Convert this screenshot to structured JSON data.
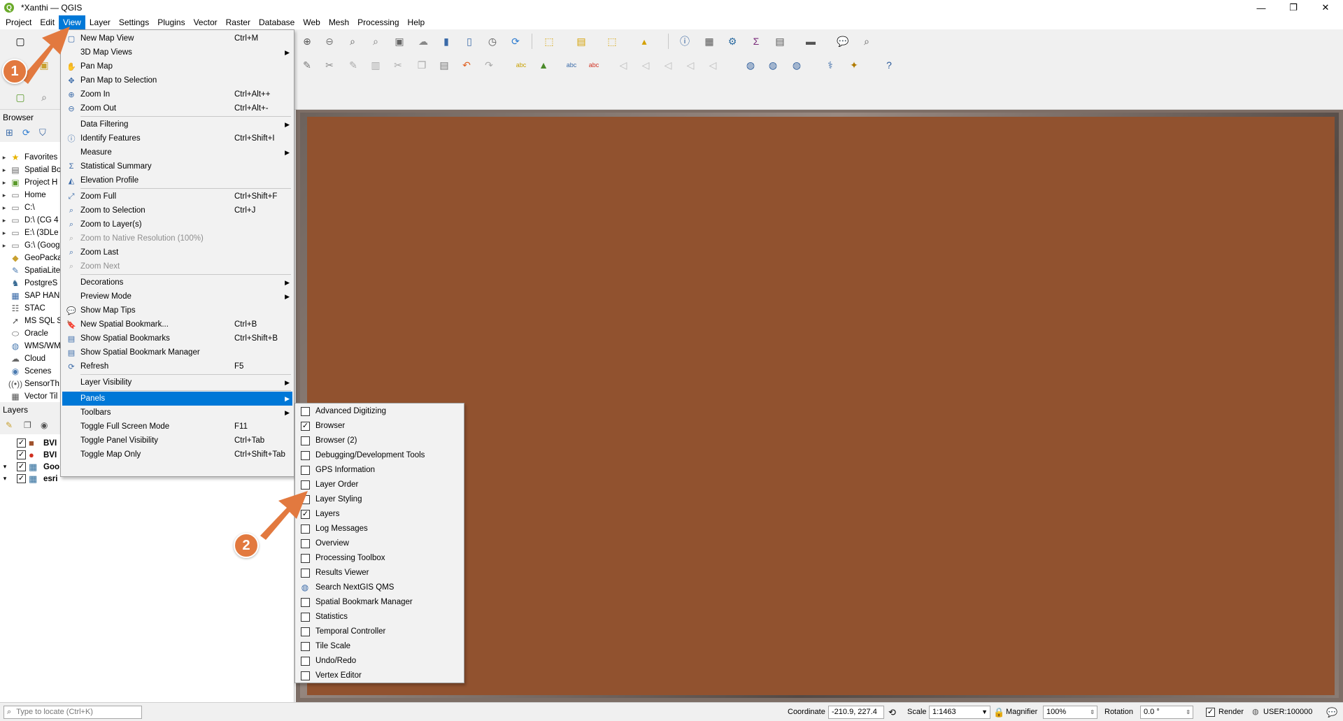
{
  "window": {
    "title": "*Xanthi — QGIS",
    "minimize": "—",
    "restore": "❐",
    "close": "✕"
  },
  "menubar": [
    "Project",
    "Edit",
    "View",
    "Layer",
    "Settings",
    "Plugins",
    "Vector",
    "Raster",
    "Database",
    "Web",
    "Mesh",
    "Processing",
    "Help"
  ],
  "browser": {
    "title": "Browser",
    "items": [
      {
        "label": "Favorites",
        "icon": "★",
        "color": "#e8b400"
      },
      {
        "label": "Spatial Bo",
        "icon": "▤",
        "color": "#666"
      },
      {
        "label": "Project H",
        "icon": "▣",
        "color": "#5a9a2a"
      },
      {
        "label": "Home",
        "icon": "▭",
        "color": "#777"
      },
      {
        "label": "C:\\",
        "icon": "▭",
        "color": "#777"
      },
      {
        "label": "D:\\ (CG 4",
        "icon": "▭",
        "color": "#777"
      },
      {
        "label": "E:\\ (3DLe",
        "icon": "▭",
        "color": "#777"
      },
      {
        "label": "G:\\ (Goog",
        "icon": "▭",
        "color": "#777"
      },
      {
        "label": "GeoPacka",
        "icon": "◆",
        "color": "#c8a030"
      },
      {
        "label": "SpatiaLite",
        "icon": "✎",
        "color": "#4a7ab0"
      },
      {
        "label": "PostgreS",
        "icon": "♞",
        "color": "#336791"
      },
      {
        "label": "SAP HAN.",
        "icon": "▦",
        "color": "#3a6aa8"
      },
      {
        "label": "STAC",
        "icon": "☷",
        "color": "#555"
      },
      {
        "label": "MS SQL S",
        "icon": "➚",
        "color": "#555"
      },
      {
        "label": "Oracle",
        "icon": "⬭",
        "color": "#555"
      },
      {
        "label": "WMS/WM",
        "icon": "◍",
        "color": "#4a7ab0"
      },
      {
        "label": "Cloud",
        "icon": "☁",
        "color": "#666"
      },
      {
        "label": "Scenes",
        "icon": "◉",
        "color": "#4a7ab0"
      },
      {
        "label": "SensorTh",
        "icon": "((•))",
        "color": "#555"
      },
      {
        "label": "Vector Til",
        "icon": "▦",
        "color": "#555"
      }
    ]
  },
  "layers": {
    "title": "Layers",
    "items": [
      {
        "label": "BVI",
        "checked": "✓",
        "icon": "■",
        "color": "#a0522d"
      },
      {
        "label": "BVI",
        "checked": "✓",
        "icon": "●",
        "color": "#d03020"
      },
      {
        "label": "Goo",
        "checked": "✓",
        "icon": "▦",
        "color": "#2a6a9a"
      },
      {
        "label": "esri",
        "checked": "✓",
        "icon": "▦",
        "color": "#2a6a9a"
      }
    ]
  },
  "view_menu": {
    "items": [
      {
        "label": "New Map View",
        "shortcut": "Ctrl+M",
        "icon": "▢"
      },
      {
        "label": "3D Map Views",
        "submenu": true
      },
      {
        "label": "Pan Map",
        "icon": "✋"
      },
      {
        "label": "Pan Map to Selection",
        "icon": "✥"
      },
      {
        "label": "Zoom In",
        "shortcut": "Ctrl+Alt++",
        "icon": "⊕"
      },
      {
        "label": "Zoom Out",
        "shortcut": "Ctrl+Alt+-",
        "icon": "⊖"
      },
      {
        "separator": true
      },
      {
        "label": "Data Filtering",
        "submenu": true
      },
      {
        "label": "Identify Features",
        "shortcut": "Ctrl+Shift+I",
        "icon": "ⓘ"
      },
      {
        "label": "Measure",
        "submenu": true
      },
      {
        "label": "Statistical Summary",
        "icon": "Σ"
      },
      {
        "label": "Elevation Profile",
        "icon": "◭"
      },
      {
        "separator": true
      },
      {
        "label": "Zoom Full",
        "shortcut": "Ctrl+Shift+F",
        "icon": "⤢"
      },
      {
        "label": "Zoom to Selection",
        "shortcut": "Ctrl+J",
        "icon": "⌕"
      },
      {
        "label": "Zoom to Layer(s)",
        "icon": "⌕"
      },
      {
        "label": "Zoom to Native Resolution (100%)",
        "icon": "⌕",
        "disabled": true
      },
      {
        "label": "Zoom Last",
        "icon": "⌕"
      },
      {
        "label": "Zoom Next",
        "icon": "⌕",
        "disabled": true
      },
      {
        "separator": true
      },
      {
        "label": "Decorations",
        "submenu": true
      },
      {
        "label": "Preview Mode",
        "submenu": true
      },
      {
        "label": "Show Map Tips",
        "icon": "💬"
      },
      {
        "label": "New Spatial Bookmark...",
        "shortcut": "Ctrl+B",
        "icon": "🔖"
      },
      {
        "label": "Show Spatial Bookmarks",
        "shortcut": "Ctrl+Shift+B",
        "icon": "▤"
      },
      {
        "label": "Show Spatial Bookmark Manager",
        "icon": "▤"
      },
      {
        "label": "Refresh",
        "shortcut": "F5",
        "icon": "⟳"
      },
      {
        "separator": true
      },
      {
        "label": "Layer Visibility",
        "submenu": true
      },
      {
        "separator": true
      },
      {
        "label": "Panels",
        "submenu": true,
        "highlighted": true
      },
      {
        "label": "Toolbars",
        "submenu": true
      },
      {
        "label": "Toggle Full Screen Mode",
        "shortcut": "F11"
      },
      {
        "label": "Toggle Panel Visibility",
        "shortcut": "Ctrl+Tab"
      },
      {
        "label": "Toggle Map Only",
        "shortcut": "Ctrl+Shift+Tab"
      }
    ]
  },
  "panels_menu": {
    "items": [
      {
        "label": "Advanced Digitizing",
        "checked": false
      },
      {
        "label": "Browser",
        "checked": true
      },
      {
        "label": "Browser (2)",
        "checked": false
      },
      {
        "label": "Debugging/Development Tools",
        "checked": false
      },
      {
        "label": "GPS Information",
        "checked": false
      },
      {
        "label": "Layer Order",
        "checked": false
      },
      {
        "label": "Layer Styling",
        "checked": false
      },
      {
        "label": "Layers",
        "checked": true
      },
      {
        "label": "Log Messages",
        "checked": false
      },
      {
        "label": "Overview",
        "checked": false
      },
      {
        "label": "Processing Toolbox",
        "checked": false
      },
      {
        "label": "Results Viewer",
        "checked": false
      },
      {
        "label": "Search NextGIS QMS",
        "checked": false,
        "icon": "◍"
      },
      {
        "label": "Spatial Bookmark Manager",
        "checked": false
      },
      {
        "label": "Statistics",
        "checked": false
      },
      {
        "label": "Temporal Controller",
        "checked": false
      },
      {
        "label": "Tile Scale",
        "checked": false
      },
      {
        "label": "Undo/Redo",
        "checked": false
      },
      {
        "label": "Vertex Editor",
        "checked": false
      }
    ]
  },
  "status": {
    "search_placeholder": "Type to locate (Ctrl+K)",
    "coordinate_label": "Coordinate",
    "coordinate_value": "-210.9, 227.4",
    "scale_label": "Scale",
    "scale_value": "1:1463",
    "magnifier_label": "Magnifier",
    "magnifier_value": "100%",
    "rotation_label": "Rotation",
    "rotation_value": "0.0 °",
    "render_label": "Render",
    "crs_label": "USER:100000"
  },
  "annotations": {
    "badge1": "1",
    "badge2": "2",
    "color": "#e2793f"
  },
  "colors": {
    "map_fill": "#91522f",
    "highlight": "#0078d7"
  }
}
